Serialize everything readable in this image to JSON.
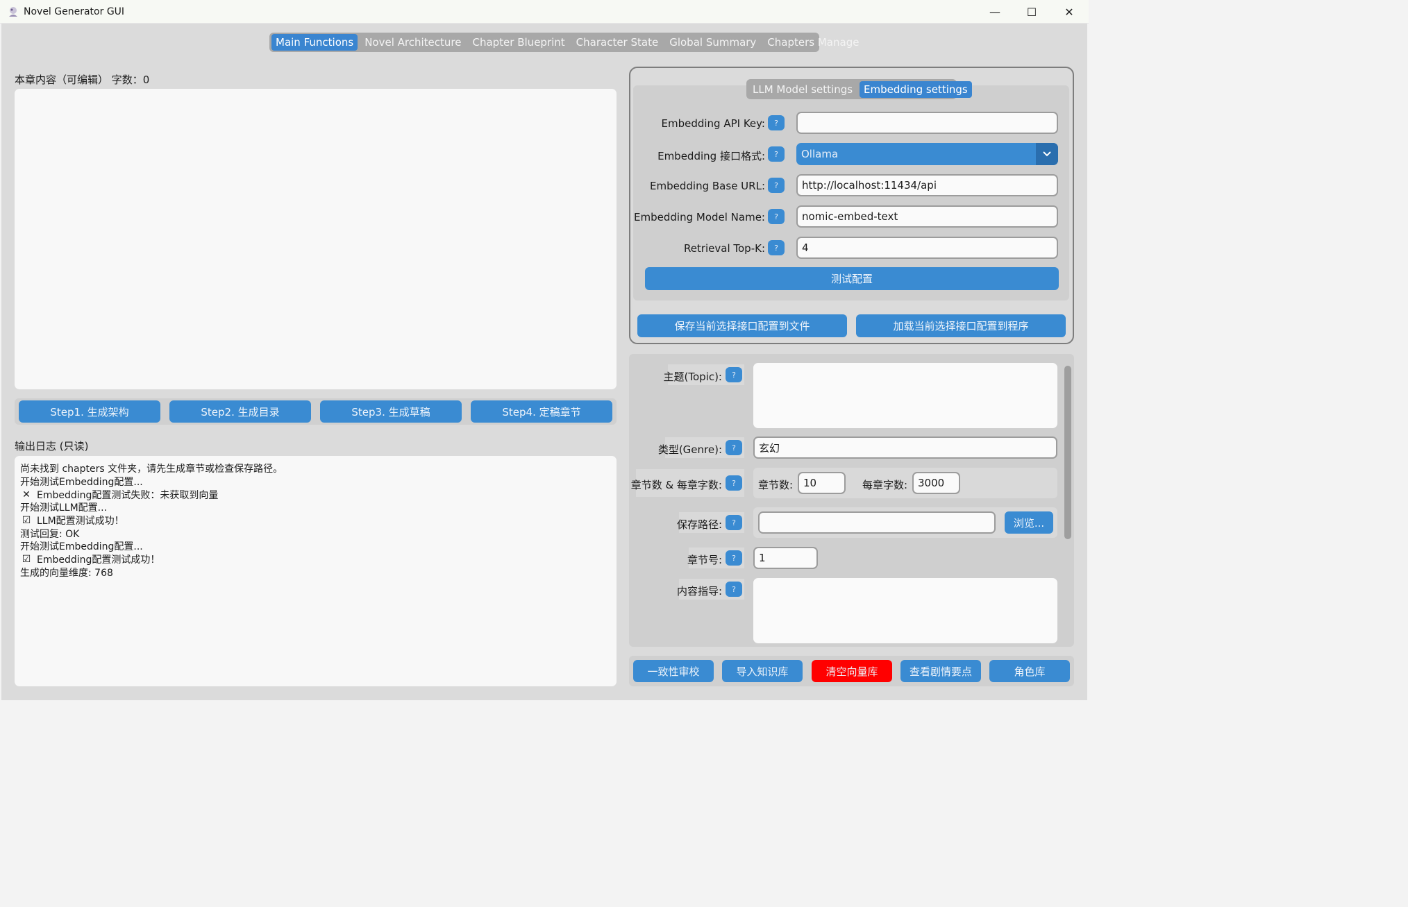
{
  "window": {
    "title": "Novel Generator GUI",
    "minimize": "—",
    "maximize": "☐",
    "close": "✕"
  },
  "tabs": [
    "Main Functions",
    "Novel Architecture",
    "Chapter Blueprint",
    "Character State",
    "Global Summary",
    "Chapters Manage"
  ],
  "editor": {
    "label": "本章内容（可编辑）  字数：0",
    "value": ""
  },
  "steps": [
    "Step1. 生成架构",
    "Step2. 生成目录",
    "Step3. 生成草稿",
    "Step4. 定稿章节"
  ],
  "log": {
    "label": "输出日志 (只读)",
    "lines": [
      {
        "icon": "",
        "text": "尚未找到 chapters 文件夹，请先生成章节或检查保存路径。"
      },
      {
        "icon": "",
        "text": "开始测试Embedding配置..."
      },
      {
        "icon": "✕",
        "text": "Embedding配置测试失败：未获取到向量"
      },
      {
        "icon": "",
        "text": "开始测试LLM配置..."
      },
      {
        "icon": "☑",
        "text": "LLM配置测试成功！"
      },
      {
        "icon": "",
        "text": "测试回复: OK"
      },
      {
        "icon": "",
        "text": "开始测试Embedding配置..."
      },
      {
        "icon": "☑",
        "text": "Embedding配置测试成功！"
      },
      {
        "icon": "",
        "text": "生成的向量维度: 768"
      }
    ]
  },
  "settings": {
    "tabs": [
      "LLM Model settings",
      "Embedding settings"
    ],
    "help": "?",
    "api_key_label": "Embedding API Key:",
    "api_key_value": "",
    "format_label": "Embedding 接口格式:",
    "format_value": "Ollama",
    "base_url_label": "Embedding Base URL:",
    "base_url_value": "http://localhost:11434/api",
    "model_label": "Embedding Model Name:",
    "model_value": "nomic-embed-text",
    "topk_label": "Retrieval Top-K:",
    "topk_value": "4",
    "test_button": "测试配置",
    "save_button": "保存当前选择接口配置到文件",
    "load_button": "加载当前选择接口配置到程序"
  },
  "params": {
    "topic_label": "主题(Topic):",
    "topic_value": "",
    "genre_label": "类型(Genre):",
    "genre_value": "玄幻",
    "chapters_label": "章节数 & 每章字数:",
    "num_chapters_label": "章节数:",
    "num_chapters_value": "10",
    "words_label": "每章字数:",
    "words_value": "3000",
    "path_label": "保存路径:",
    "path_value": "",
    "browse_button": "浏览...",
    "chapter_no_label": "章节号:",
    "chapter_no_value": "1",
    "guide_label": "内容指导:",
    "guide_value": ""
  },
  "bottom_buttons": [
    "一致性审校",
    "导入知识库",
    "清空向量库",
    "查看剧情要点",
    "角色库"
  ],
  "colors": {
    "accent": "#3a8bd2",
    "danger": "#ff0000"
  }
}
